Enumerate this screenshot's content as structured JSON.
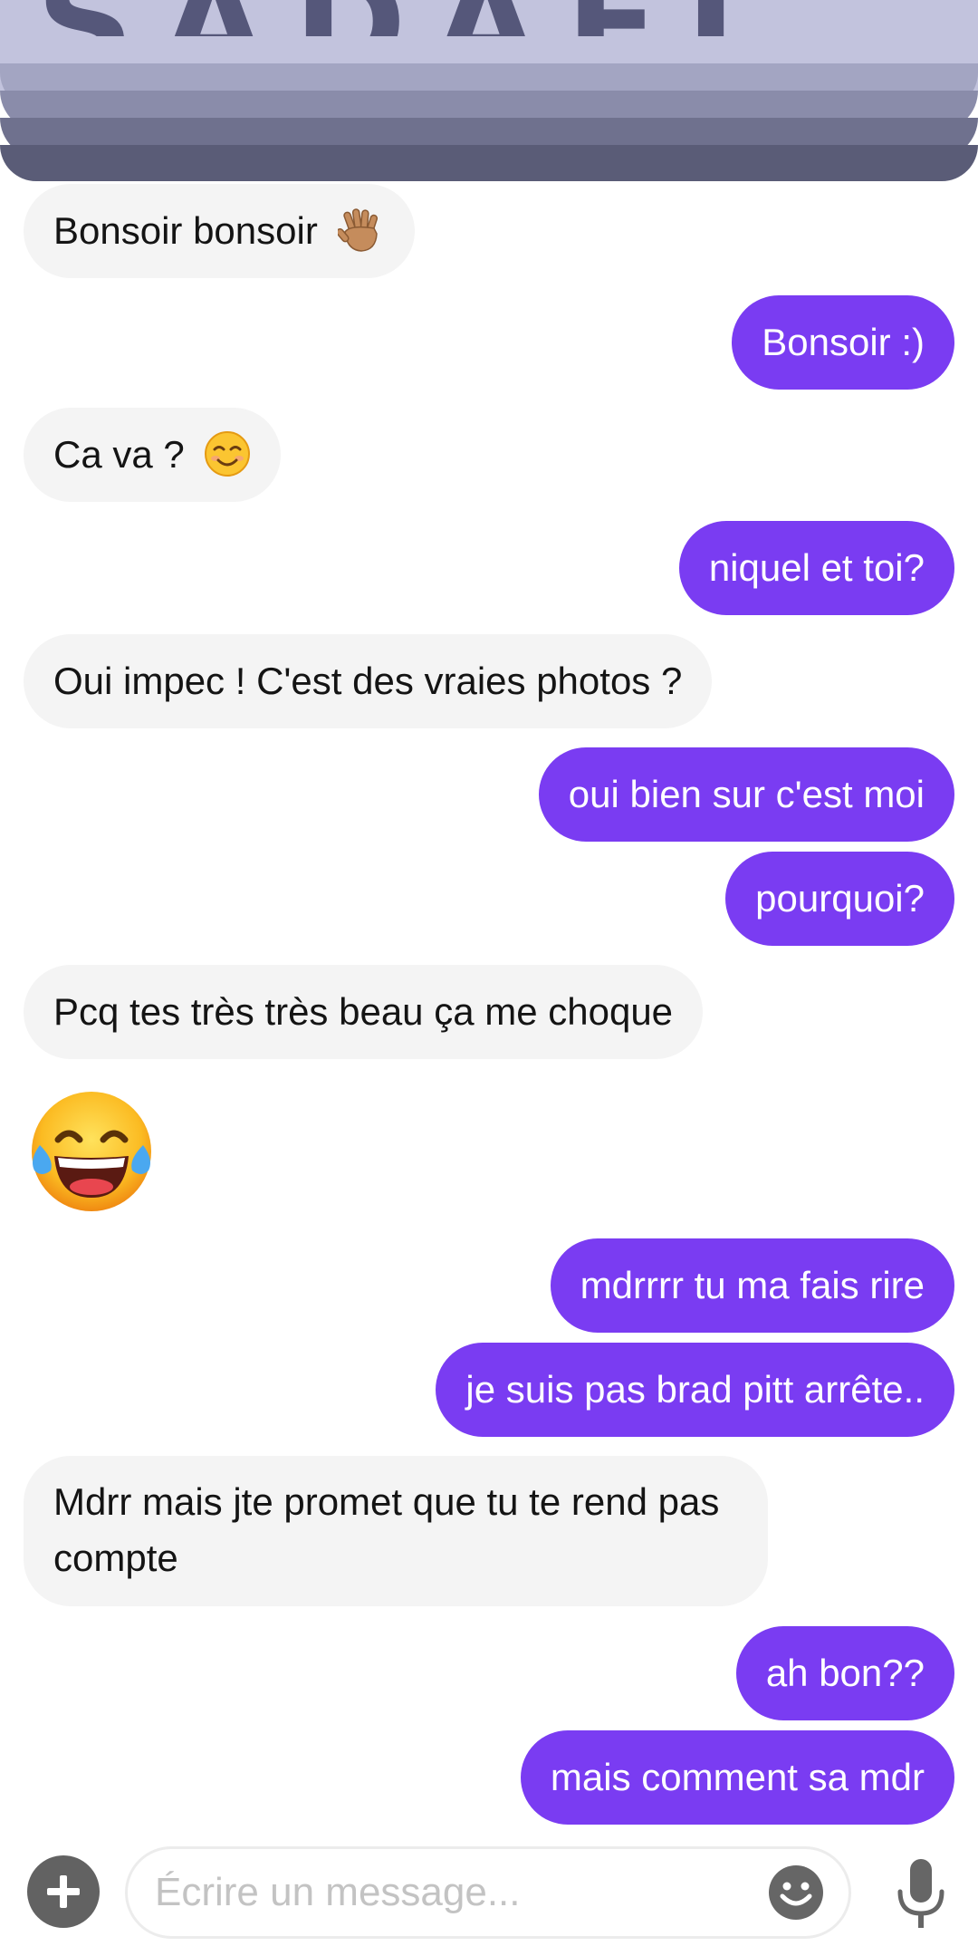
{
  "colors": {
    "outgoing_bubble": "#7a3cf2",
    "incoming_bubble": "#f4f4f4",
    "banner": "#6f718e"
  },
  "header": {
    "banner_text": "SADAEL"
  },
  "messages": [
    {
      "from": "them",
      "text": "Bonsoir bonsoir",
      "emoji": "waving-hand-icon"
    },
    {
      "from": "me",
      "text": "Bonsoir :)"
    },
    {
      "from": "them",
      "text": "Ca va ?",
      "emoji": "smiling-face-icon"
    },
    {
      "from": "me",
      "text": "niquel et toi?"
    },
    {
      "from": "them",
      "text": "Oui impec ! C'est des vraies photos ?"
    },
    {
      "from": "me",
      "text": "oui bien sur c'est moi"
    },
    {
      "from": "me",
      "text": "pourquoi?"
    },
    {
      "from": "them",
      "text": "Pcq tes très très beau ça me choque"
    },
    {
      "from": "them",
      "emoji": "tears-of-joy-icon"
    },
    {
      "from": "me",
      "text": "mdrrrr tu ma fais rire"
    },
    {
      "from": "me",
      "text": "je suis pas brad pitt arrête.."
    },
    {
      "from": "them",
      "text": "Mdrr mais jte promet que tu te rend pas compte"
    },
    {
      "from": "me",
      "text": "ah bon??"
    },
    {
      "from": "me",
      "text": "mais comment sa mdr"
    }
  ],
  "composer": {
    "placeholder": "Écrire un message...",
    "add_icon": "plus-icon",
    "emoji_icon": "smiley-icon",
    "mic_icon": "microphone-icon"
  }
}
